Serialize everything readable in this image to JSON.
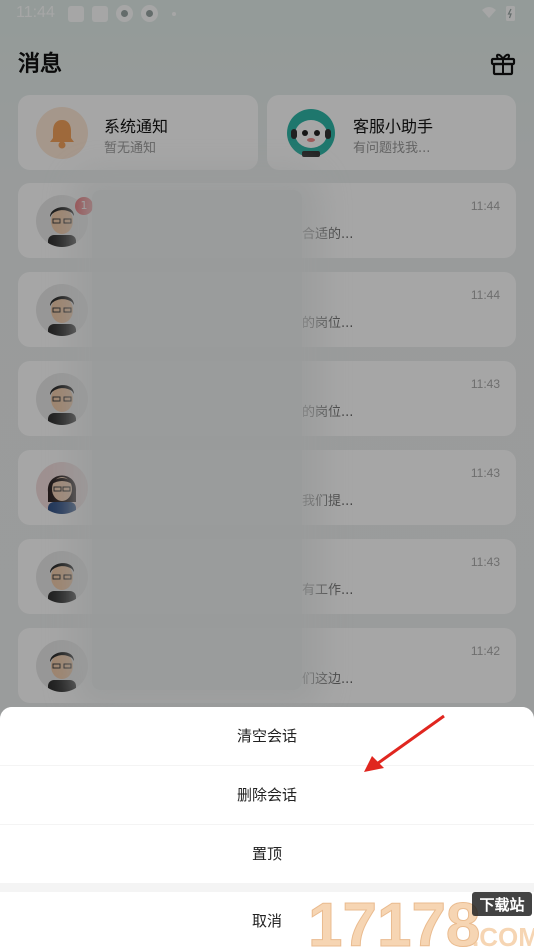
{
  "status_bar": {
    "time": "11:44"
  },
  "header": {
    "title": "消息"
  },
  "top_cards": [
    {
      "title": "系统通知",
      "subtitle": "暂无通知"
    },
    {
      "title": "客服小助手",
      "subtitle": "有问题找我..."
    }
  ],
  "conversations": [
    {
      "time": "11:44",
      "preview": "合适的...",
      "badge": "1"
    },
    {
      "time": "11:44",
      "preview": "的岗位..."
    },
    {
      "time": "11:43",
      "preview": "的岗位..."
    },
    {
      "time": "11:43",
      "preview": "我们提..."
    },
    {
      "time": "11:43",
      "preview": "有工作..."
    },
    {
      "time": "11:42",
      "preview": "们这边..."
    }
  ],
  "action_sheet": {
    "clear": "清空会话",
    "delete": "删除会话",
    "pin": "置顶",
    "cancel": "取消"
  },
  "watermark": {
    "number": "17178",
    "domain": ".COM",
    "tag": "下载站"
  },
  "colors": {
    "badge": "#e8333a",
    "arrow": "#e0261f",
    "bell": "#f3a25b"
  }
}
